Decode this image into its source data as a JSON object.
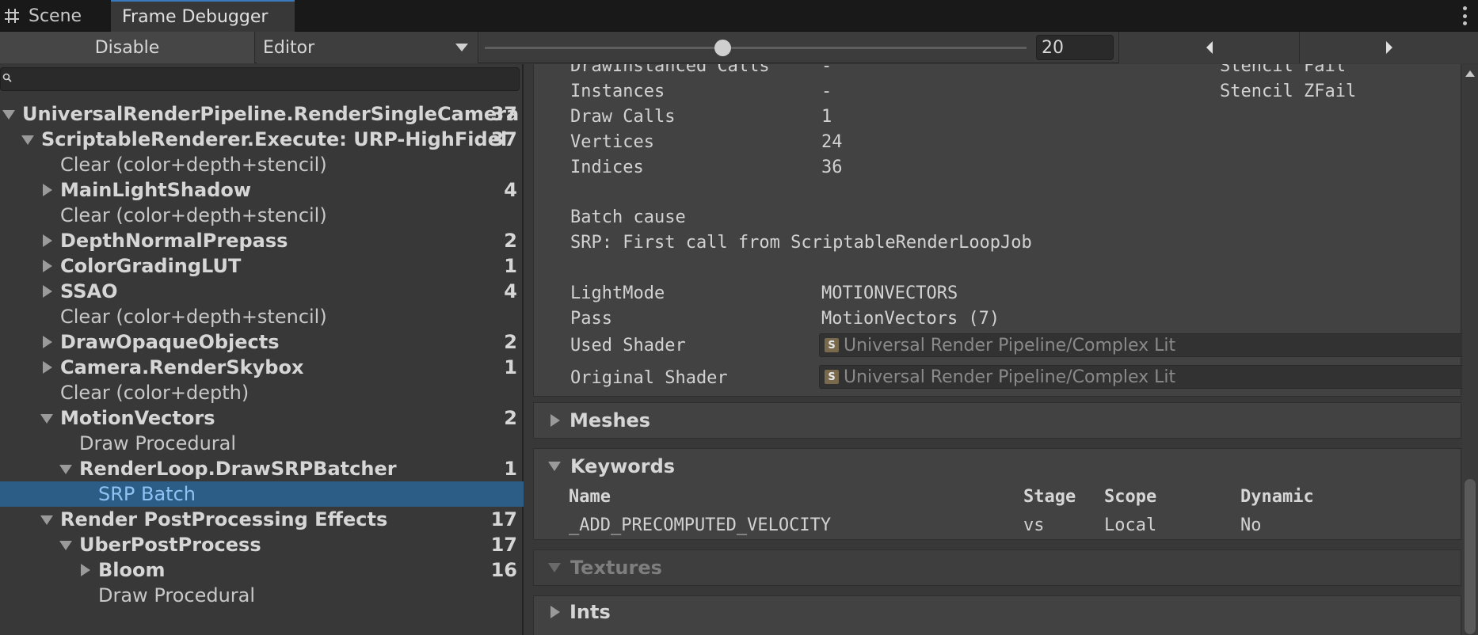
{
  "tabs": {
    "scene": "Scene",
    "frame_debugger": "Frame Debugger"
  },
  "toolbar": {
    "disable_label": "Disable",
    "target_selected": "Editor",
    "frame_value": "20",
    "slider_fraction": 0.44
  },
  "tree": [
    {
      "label": "UniversalRenderPipeline.RenderSingleCamera",
      "count": "37",
      "bold": true,
      "depth": 0,
      "fold": "open"
    },
    {
      "label": "ScriptableRenderer.Execute: URP-HighFidel",
      "count": "37",
      "bold": true,
      "depth": 1,
      "fold": "open"
    },
    {
      "label": "Clear (color+depth+stencil)",
      "count": "",
      "bold": false,
      "depth": 2,
      "fold": "none"
    },
    {
      "label": "MainLightShadow",
      "count": "4",
      "bold": true,
      "depth": 2,
      "fold": "closed"
    },
    {
      "label": "Clear (color+depth+stencil)",
      "count": "",
      "bold": false,
      "depth": 2,
      "fold": "none"
    },
    {
      "label": "DepthNormalPrepass",
      "count": "2",
      "bold": true,
      "depth": 2,
      "fold": "closed"
    },
    {
      "label": "ColorGradingLUT",
      "count": "1",
      "bold": true,
      "depth": 2,
      "fold": "closed"
    },
    {
      "label": "SSAO",
      "count": "4",
      "bold": true,
      "depth": 2,
      "fold": "closed"
    },
    {
      "label": "Clear (color+depth+stencil)",
      "count": "",
      "bold": false,
      "depth": 2,
      "fold": "none"
    },
    {
      "label": "DrawOpaqueObjects",
      "count": "2",
      "bold": true,
      "depth": 2,
      "fold": "closed"
    },
    {
      "label": "Camera.RenderSkybox",
      "count": "1",
      "bold": true,
      "depth": 2,
      "fold": "closed"
    },
    {
      "label": "Clear (color+depth)",
      "count": "",
      "bold": false,
      "depth": 2,
      "fold": "none"
    },
    {
      "label": "MotionVectors",
      "count": "2",
      "bold": true,
      "depth": 2,
      "fold": "open"
    },
    {
      "label": "Draw Procedural",
      "count": "",
      "bold": false,
      "depth": 3,
      "fold": "none"
    },
    {
      "label": "RenderLoop.DrawSRPBatcher",
      "count": "1",
      "bold": true,
      "depth": 3,
      "fold": "open"
    },
    {
      "label": "SRP Batch",
      "count": "",
      "bold": false,
      "depth": 4,
      "fold": "none",
      "selected": true
    },
    {
      "label": "Render PostProcessing Effects",
      "count": "17",
      "bold": true,
      "depth": 2,
      "fold": "open"
    },
    {
      "label": "UberPostProcess",
      "count": "17",
      "bold": true,
      "depth": 3,
      "fold": "open"
    },
    {
      "label": "Bloom",
      "count": "16",
      "bold": true,
      "depth": 4,
      "fold": "closed"
    },
    {
      "label": "Draw Procedural",
      "count": "",
      "bold": false,
      "depth": 4,
      "fold": "none"
    }
  ],
  "details": {
    "draw_instanced_label": "DrawInstanced Calls",
    "draw_instanced_value": "-",
    "instances_label": "Instances",
    "instances_value": "-",
    "draw_calls_label": "Draw Calls",
    "draw_calls_value": "1",
    "vertices_label": "Vertices",
    "vertices_value": "24",
    "indices_label": "Indices",
    "indices_value": "36",
    "stencil_fail": "Stencil Fail",
    "stencil_zfail": "Stencil ZFail",
    "batch_cause_label": "Batch cause",
    "batch_cause_value": "SRP: First call from ScriptableRenderLoopJob",
    "lightmode_label": "LightMode",
    "lightmode_value": "MOTIONVECTORS",
    "pass_label": "Pass",
    "pass_value": "MotionVectors (7)",
    "used_shader_label": "Used Shader",
    "used_shader_value": "Universal Render Pipeline/Complex Lit",
    "original_shader_label": "Original Shader",
    "original_shader_value": "Universal Render Pipeline/Complex Lit"
  },
  "sections": {
    "meshes": "Meshes",
    "keywords": "Keywords",
    "textures": "Textures",
    "ints": "Ints"
  },
  "keywords_table": {
    "headers": {
      "name": "Name",
      "stage": "Stage",
      "scope": "Scope",
      "dynamic": "Dynamic"
    },
    "row": {
      "name": "_ADD_PRECOMPUTED_VELOCITY",
      "stage": "vs",
      "scope": "Local",
      "dynamic": "No"
    }
  },
  "icons": {
    "scene_tab": "grid-icon",
    "menu": "kebab-menu-icon",
    "search": "search-icon",
    "shader": "shader-icon"
  },
  "colors": {
    "selection": "#2c5d87",
    "selection_text": "#8ec2f2",
    "tab_accent": "#3a79bb"
  }
}
